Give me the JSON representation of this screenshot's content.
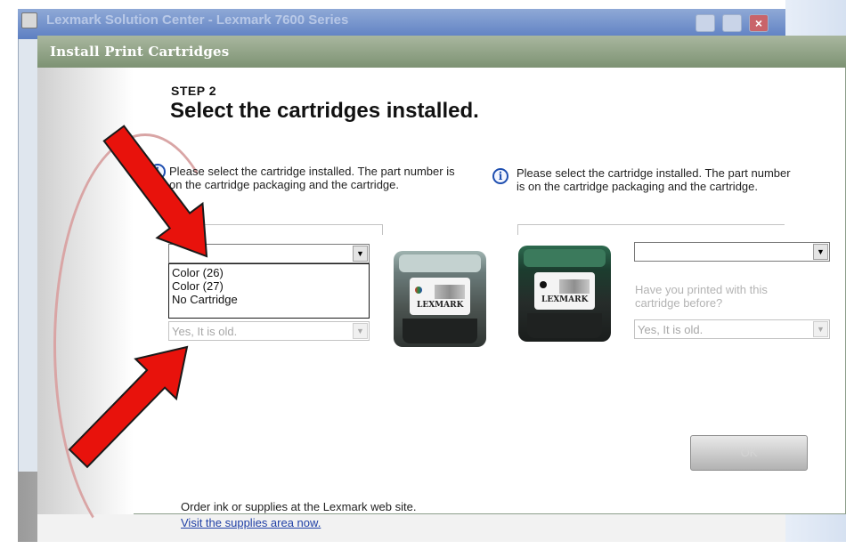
{
  "background_window": {
    "title": "Lexmark Solution Center - Lexmark 7600 Series"
  },
  "dialog": {
    "title": "Install Print Cartridges",
    "step_label": "STEP 2",
    "heading": "Select the cartridges installed."
  },
  "left_panel": {
    "info_text": "Please select the cartridge installed. The part number is on the cartridge packaging and the cartridge.",
    "dropdown_options": [
      "Color (26)",
      "Color (27)",
      "No Cartridge"
    ],
    "age_select_value": "Yes, It is old."
  },
  "right_panel": {
    "info_text": "Please select the cartridge installed. The part number is on the cartridge packaging and the cartridge.",
    "question": "Have you printed with this cartridge before?",
    "age_select_value": "Yes, It is old."
  },
  "cartridges": {
    "brand": "LEXMARK"
  },
  "buttons": {
    "ok": "OK"
  },
  "footer": {
    "order_text": "Order ink or supplies at the Lexmark web site.",
    "visit_link": "Visit the supplies area now."
  },
  "annotation": {
    "arrow_color": "#e8120c"
  },
  "icons": [
    "info-icon",
    "dropdown-arrow-icon",
    "printer-app-icon",
    "close-icon"
  ]
}
